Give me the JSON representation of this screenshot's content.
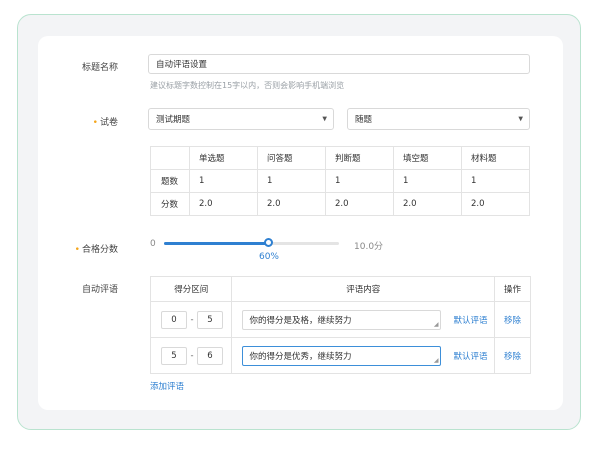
{
  "form": {
    "title_label": "标题名称",
    "title_value": "自动评语设置",
    "title_hint": "建议标题字数控制在15字以内，否则会影响手机端浏览",
    "paper_label": "试卷",
    "paper_select": "测试期题",
    "question_select": "随题",
    "pass_label": "合格分数",
    "auto_label": "自动评语",
    "add_comment": "添加评语"
  },
  "score_table": {
    "headers": [
      "",
      "单选题",
      "问答题",
      "判断题",
      "填空题",
      "材料题"
    ],
    "rows": [
      [
        "题数",
        "1",
        "1",
        "1",
        "1",
        "1"
      ],
      [
        "分数",
        "2.0",
        "2.0",
        "2.0",
        "2.0",
        "2.0"
      ]
    ]
  },
  "slider": {
    "min_label": "0",
    "max_label": "10.0分",
    "value_label": "60%",
    "value": 0.6
  },
  "comments": {
    "headers": [
      "得分区间",
      "评语内容",
      "操作"
    ],
    "rows": [
      {
        "from": "0",
        "to": "5",
        "text": "你的得分是及格，继续努力",
        "default_label": "默认评语",
        "remove_label": "移除"
      },
      {
        "from": "5",
        "to": "6",
        "text": "你的得分是优秀，继续努力",
        "default_label": "默认评语",
        "remove_label": "移除"
      }
    ]
  },
  "colors": {
    "accent": "#2f80d1",
    "required": "#f4a61c",
    "frame": "#b9e3cf"
  }
}
